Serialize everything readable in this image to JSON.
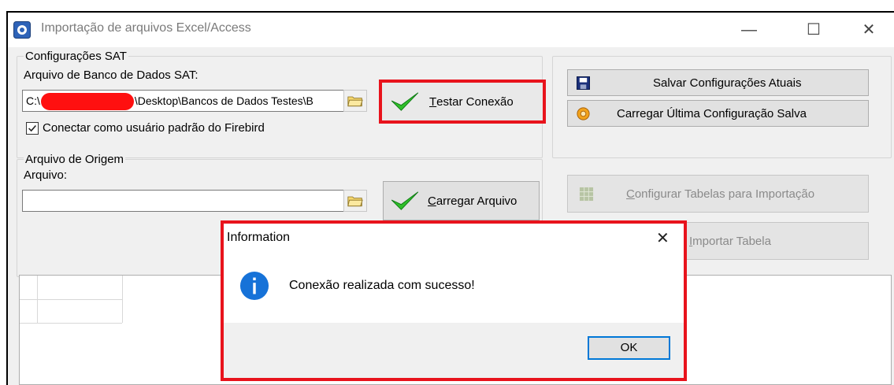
{
  "window": {
    "title": "Importação de arquivos Excel/Access",
    "controls": {
      "minimize": "—",
      "maximize": "☐",
      "close": "✕"
    }
  },
  "config_sat": {
    "group_label": "Configurações SAT",
    "db_file_label": "Arquivo de Banco de Dados SAT:",
    "db_path_prefix": "C:\\",
    "db_path_suffix": "\\Desktop\\Bancos de Dados Testes\\B",
    "test_button": {
      "accel": "T",
      "rest": "estar Conexão"
    },
    "checkbox": {
      "label": "Conectar como usuário padrão do Firebird",
      "checked": true
    }
  },
  "actions": {
    "save_button": "Salvar Configurações Atuais",
    "load_button": "Carregar Última Configuração Salva"
  },
  "origem": {
    "group_label": "Arquivo de Origem",
    "file_label": "Arquivo:",
    "file_value": "",
    "load_button": {
      "accel": "C",
      "rest": "arregar Arquivo"
    },
    "configure_button": {
      "accel": "C",
      "rest": "onfigurar Tabelas para Importação"
    },
    "import_button": {
      "accel": "I",
      "rest": "mportar Tabela"
    }
  },
  "dialog": {
    "title": "Information",
    "message": "Conexão realizada com sucesso!",
    "ok": "OK",
    "close": "✕"
  },
  "colors": {
    "highlight": "#e8131c",
    "info_icon": "#1672d8",
    "accent_focus": "#0078d7"
  }
}
